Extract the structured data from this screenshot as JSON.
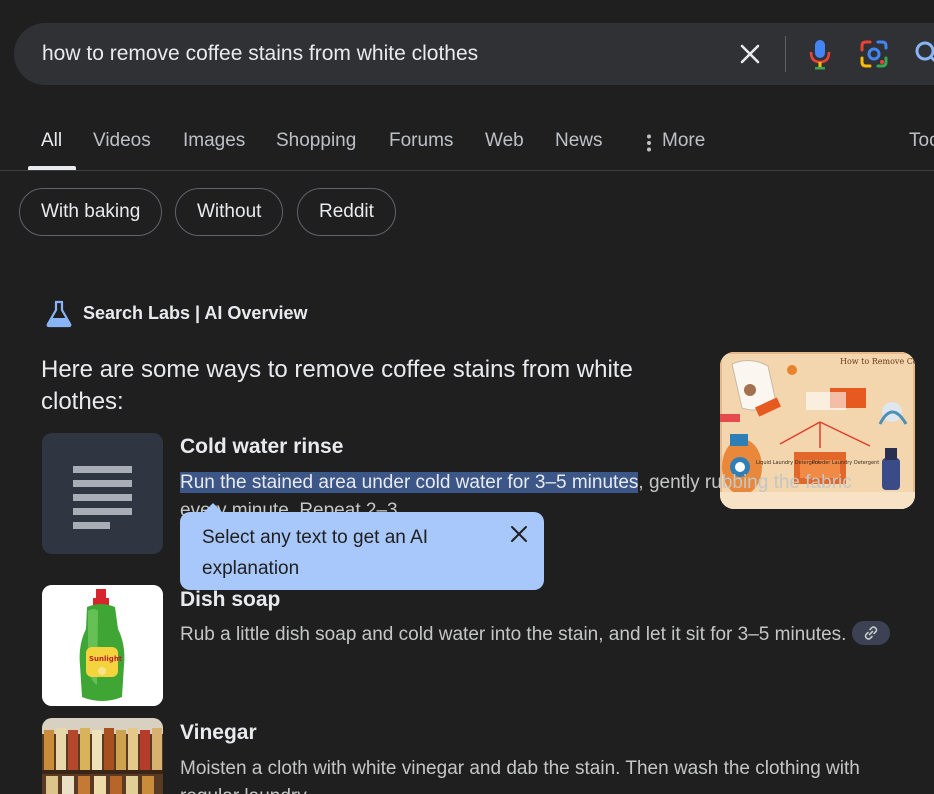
{
  "search": {
    "query": "how to remove coffee stains from white clothes"
  },
  "tabs": [
    {
      "label": "All",
      "active": true
    },
    {
      "label": "Videos"
    },
    {
      "label": "Images"
    },
    {
      "label": "Shopping"
    },
    {
      "label": "Forums"
    },
    {
      "label": "Web"
    },
    {
      "label": "News"
    },
    {
      "label": "More"
    },
    {
      "label": "Tools"
    }
  ],
  "chips": [
    "With baking",
    "Without",
    "Reddit"
  ],
  "ai_overview": {
    "header": "Search Labs | AI Overview",
    "intro": "Here are some ways to remove coffee stains from white clothes:",
    "infographic_title": "How to Remove Coffee Stains on Clothing",
    "infographic_labels": [
      "Liquid Laundry Detergent",
      "Powder Laundry Detergent"
    ],
    "items": [
      {
        "title": "Cold water rinse",
        "highlighted": "Run the stained area under cold water for 3–5 minutes",
        "rest": ", gently rubbing the fabric every minute. Repeat 2–3"
      },
      {
        "title": "Dish soap",
        "text": "Rub a little dish soap and cold water into the stain, and let it sit for 3–5 minutes."
      },
      {
        "title": "Vinegar",
        "text": "Moisten a cloth with white vinegar and dab the stain. Then wash the clothing with regular laundry"
      }
    ]
  },
  "tooltip": {
    "text": "Select any text to get an AI explanation"
  },
  "colors": {
    "background": "#1f1f1f",
    "searchbar": "#303134",
    "tooltip": "#a8c7fa",
    "highlight": "#3c5687"
  }
}
